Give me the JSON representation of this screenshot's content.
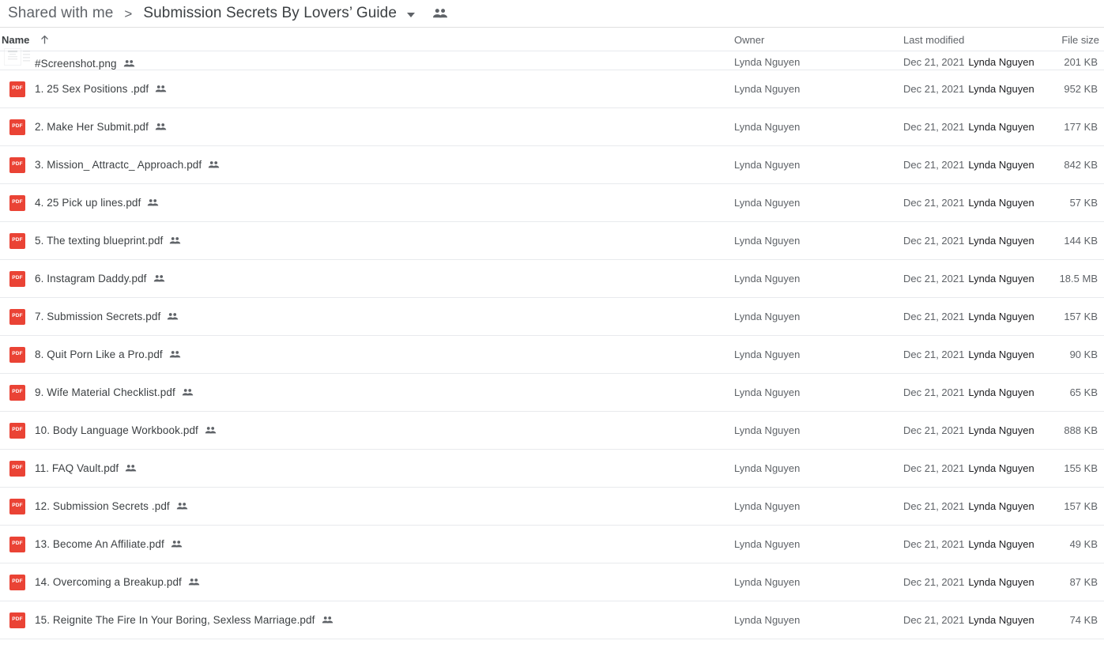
{
  "breadcrumb": {
    "root_label": "Shared with me",
    "separator": ">",
    "current_label": "Submission Secrets By Lovers’ Guide",
    "dropdown_icon": "chevron-down-icon",
    "people_icon": "people-group-icon"
  },
  "columns": {
    "name": "Name",
    "sort_icon": "arrow-up-icon",
    "owner": "Owner",
    "last_modified": "Last modified",
    "file_size": "File size"
  },
  "files": [
    {
      "icon": "image-thumbnail-icon",
      "name": "#Screenshot.png",
      "shared_icon": "shared-people-icon",
      "owner": "Lynda Nguyen",
      "modified_date": "Dec 21, 2021",
      "modified_by": "Lynda Nguyen",
      "size": "201 KB",
      "clipped": true
    },
    {
      "icon": "pdf-icon",
      "name": "1. 25 Sex Positions .pdf",
      "shared_icon": "shared-people-icon",
      "owner": "Lynda Nguyen",
      "modified_date": "Dec 21, 2021",
      "modified_by": "Lynda Nguyen",
      "size": "952 KB",
      "clipped": false
    },
    {
      "icon": "pdf-icon",
      "name": "2. Make Her Submit.pdf",
      "shared_icon": "shared-people-icon",
      "owner": "Lynda Nguyen",
      "modified_date": "Dec 21, 2021",
      "modified_by": "Lynda Nguyen",
      "size": "177 KB",
      "clipped": false
    },
    {
      "icon": "pdf-icon",
      "name": "3. Mission_ Attractc_ Approach.pdf",
      "shared_icon": "shared-people-icon",
      "owner": "Lynda Nguyen",
      "modified_date": "Dec 21, 2021",
      "modified_by": "Lynda Nguyen",
      "size": "842 KB",
      "clipped": false
    },
    {
      "icon": "pdf-icon",
      "name": "4. 25 Pick up lines.pdf",
      "shared_icon": "shared-people-icon",
      "owner": "Lynda Nguyen",
      "modified_date": "Dec 21, 2021",
      "modified_by": "Lynda Nguyen",
      "size": "57 KB",
      "clipped": false
    },
    {
      "icon": "pdf-icon",
      "name": "5. The texting blueprint.pdf",
      "shared_icon": "shared-people-icon",
      "owner": "Lynda Nguyen",
      "modified_date": "Dec 21, 2021",
      "modified_by": "Lynda Nguyen",
      "size": "144 KB",
      "clipped": false
    },
    {
      "icon": "pdf-icon",
      "name": "6. Instagram Daddy.pdf",
      "shared_icon": "shared-people-icon",
      "owner": "Lynda Nguyen",
      "modified_date": "Dec 21, 2021",
      "modified_by": "Lynda Nguyen",
      "size": "18.5 MB",
      "clipped": false
    },
    {
      "icon": "pdf-icon",
      "name": "7. Submission Secrets.pdf",
      "shared_icon": "shared-people-icon",
      "owner": "Lynda Nguyen",
      "modified_date": "Dec 21, 2021",
      "modified_by": "Lynda Nguyen",
      "size": "157 KB",
      "clipped": false
    },
    {
      "icon": "pdf-icon",
      "name": "8. Quit Porn Like a Pro.pdf",
      "shared_icon": "shared-people-icon",
      "owner": "Lynda Nguyen",
      "modified_date": "Dec 21, 2021",
      "modified_by": "Lynda Nguyen",
      "size": "90 KB",
      "clipped": false
    },
    {
      "icon": "pdf-icon",
      "name": "9. Wife Material Checklist.pdf",
      "shared_icon": "shared-people-icon",
      "owner": "Lynda Nguyen",
      "modified_date": "Dec 21, 2021",
      "modified_by": "Lynda Nguyen",
      "size": "65 KB",
      "clipped": false
    },
    {
      "icon": "pdf-icon",
      "name": "10. Body Language Workbook.pdf",
      "shared_icon": "shared-people-icon",
      "owner": "Lynda Nguyen",
      "modified_date": "Dec 21, 2021",
      "modified_by": "Lynda Nguyen",
      "size": "888 KB",
      "clipped": false
    },
    {
      "icon": "pdf-icon",
      "name": "11. FAQ Vault.pdf",
      "shared_icon": "shared-people-icon",
      "owner": "Lynda Nguyen",
      "modified_date": "Dec 21, 2021",
      "modified_by": "Lynda Nguyen",
      "size": "155 KB",
      "clipped": false
    },
    {
      "icon": "pdf-icon",
      "name": "12. Submission Secrets .pdf",
      "shared_icon": "shared-people-icon",
      "owner": "Lynda Nguyen",
      "modified_date": "Dec 21, 2021",
      "modified_by": "Lynda Nguyen",
      "size": "157 KB",
      "clipped": false
    },
    {
      "icon": "pdf-icon",
      "name": "13. Become An Affiliate.pdf",
      "shared_icon": "shared-people-icon",
      "owner": "Lynda Nguyen",
      "modified_date": "Dec 21, 2021",
      "modified_by": "Lynda Nguyen",
      "size": "49 KB",
      "clipped": false
    },
    {
      "icon": "pdf-icon",
      "name": "14. Overcoming a Breakup.pdf",
      "shared_icon": "shared-people-icon",
      "owner": "Lynda Nguyen",
      "modified_date": "Dec 21, 2021",
      "modified_by": "Lynda Nguyen",
      "size": "87 KB",
      "clipped": false
    },
    {
      "icon": "pdf-icon",
      "name": "15. Reignite The Fire In Your Boring, Sexless Marriage.pdf",
      "shared_icon": "shared-people-icon",
      "owner": "Lynda Nguyen",
      "modified_date": "Dec 21, 2021",
      "modified_by": "Lynda Nguyen",
      "size": "74 KB",
      "clipped": false
    }
  ],
  "colors": {
    "pdf_red": "#ea4335",
    "text_primary": "#3c4043",
    "text_secondary": "#5f6368",
    "text_dark": "#202124",
    "row_divider": "#e8eaed"
  },
  "pdf_badge_label": "PDF"
}
